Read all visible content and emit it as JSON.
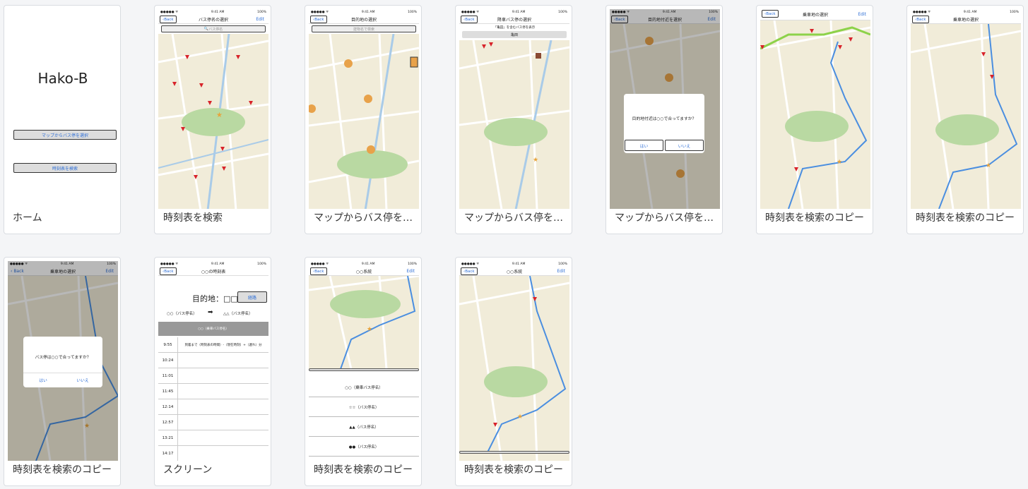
{
  "cards": [
    {
      "caption": "ホーム",
      "title": "Hako-B",
      "btn1": "マップからバス停を選択",
      "btn2": "時刻表を検索"
    },
    {
      "caption": "時刻表を検索",
      "nav": "バス停名の選択",
      "back": "Back",
      "edit": "Edit",
      "search": "バス停名"
    },
    {
      "caption": "マップからバス停を選択",
      "nav": "目的地の選択",
      "back": "Back",
      "search": "建物名で検索"
    },
    {
      "caption": "マップからバス停を選択",
      "nav": "降車バス停の選択",
      "back": "Back",
      "sub": "「亀田」を含むバス停を表示",
      "field": "亀田"
    },
    {
      "caption": "マップからバス停を選択",
      "nav": "目的地付近を選択",
      "back": "Back",
      "edit": "Edit",
      "question": "目的地付近は○○で合ってますか？",
      "yes": "はい",
      "no": "いいえ"
    },
    {
      "caption": "時刻表を検索のコピー",
      "nav": "乗車地の選択",
      "back": "Back",
      "edit": "Edit"
    },
    {
      "caption": "時刻表を検索のコピー",
      "nav": "乗車地の選択",
      "back": "Back"
    },
    {
      "caption": "時刻表を検索のコピー",
      "nav": "乗車地の選択",
      "back": "Back",
      "edit": "Edit",
      "question": "バス停は○○で合ってますか？",
      "yes": "はい",
      "no": "いいえ"
    },
    {
      "caption": "スクリーン",
      "nav": "○○の時刻表",
      "back": "Back",
      "dest": "目的地：□□",
      "route": "経路",
      "from": "○○（バス停名）",
      "to": "△△（バス停名）",
      "header": "○○（乗車バス停名）",
      "note": "到着まで（時刻表の時間）-（現在時刻）+（遅れ）分",
      "times": [
        "9:55",
        "10:24",
        "11:01",
        "11:45",
        "12:14",
        "12:57",
        "13:21",
        "14:17"
      ]
    },
    {
      "caption": "時刻表を検索のコピー",
      "nav": "○○系統",
      "back": "Back",
      "edit": "Edit",
      "stops": [
        "○○（乗車バス停名）",
        "☆☆（バス停名）",
        "▲▲（バス停名）",
        "●●（バス停名）"
      ]
    },
    {
      "caption": "時刻表を検索のコピー",
      "nav": "○○系統",
      "back": "Back",
      "edit": "Edit"
    }
  ],
  "status": {
    "carrier": "●●●●● ᯤ",
    "time": "9:41 AM",
    "battery": "100%"
  }
}
